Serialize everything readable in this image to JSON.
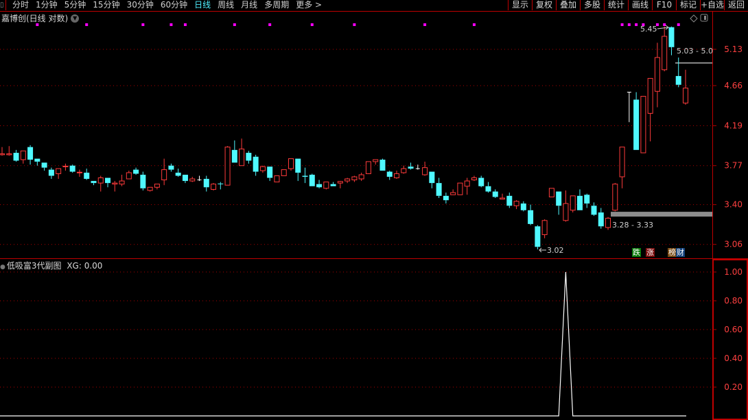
{
  "toolbar": {
    "tabs": [
      "分时",
      "1分钟",
      "5分钟",
      "15分钟",
      "30分钟",
      "60分钟",
      "日线",
      "周线",
      "月线",
      "多周期",
      "更多 >"
    ],
    "active_tab": "日线",
    "buttons": [
      "显示",
      "复权",
      "叠加",
      "多股",
      "统计",
      "画线",
      "F10",
      "标记",
      "+自选",
      "返回"
    ]
  },
  "main_chart": {
    "title": "嘉博创(日线 对数)",
    "scale": "log",
    "y_ticks": [
      "5.13",
      "4.66",
      "4.19",
      "3.77",
      "3.40",
      "3.06"
    ],
    "high_label": "5.45",
    "low_label": "3.02",
    "range_label_low": "3.28 - 3.33",
    "range_label_high": "5.03 - 5.0",
    "badges": {
      "down": "跌",
      "up": "涨",
      "rank": "榜",
      "finance": "财"
    },
    "colors": {
      "up": "#ff3b3b",
      "down": "#4ff8ff",
      "flat": "#ffffff",
      "grid": "#b00000",
      "axis_text": "#ff4040",
      "marker": "#ff00ff",
      "zone": "#8c8c8c"
    },
    "marker_indices": [
      5,
      12,
      20,
      24,
      26,
      33,
      38,
      44,
      50,
      60,
      67,
      88,
      89,
      90,
      91,
      93,
      94,
      96
    ]
  },
  "chart_data": [
    {
      "type": "candlestick",
      "title": "嘉博创(日线 对数)",
      "fields": [
        "open",
        "high",
        "low",
        "close"
      ],
      "ylim": [
        3.0,
        5.5
      ],
      "grid": true,
      "candles": [
        [
          3.88,
          3.96,
          3.87,
          3.89
        ],
        [
          3.88,
          3.97,
          3.87,
          3.89
        ],
        [
          3.9,
          3.93,
          3.81,
          3.82
        ],
        [
          3.83,
          3.92,
          3.79,
          3.92
        ],
        [
          3.96,
          3.98,
          3.78,
          3.83
        ],
        [
          3.84,
          3.84,
          3.77,
          3.81
        ],
        [
          3.8,
          3.8,
          3.72,
          3.75
        ],
        [
          3.73,
          3.75,
          3.64,
          3.67
        ],
        [
          3.69,
          3.74,
          3.64,
          3.74
        ],
        [
          3.76,
          3.79,
          3.72,
          3.765
        ],
        [
          3.77,
          3.78,
          3.7,
          3.71
        ],
        [
          3.7,
          3.73,
          3.66,
          3.705
        ],
        [
          3.7,
          3.74,
          3.63,
          3.64
        ],
        [
          3.62,
          3.62,
          3.58,
          3.6
        ],
        [
          3.6,
          3.67,
          3.52,
          3.65
        ],
        [
          3.65,
          3.65,
          3.56,
          3.6
        ],
        [
          3.59,
          3.62,
          3.52,
          3.6
        ],
        [
          3.59,
          3.68,
          3.57,
          3.62
        ],
        [
          3.64,
          3.72,
          3.64,
          3.7
        ],
        [
          3.73,
          3.75,
          3.68,
          3.69
        ],
        [
          3.68,
          3.71,
          3.53,
          3.55
        ],
        [
          3.53,
          3.56,
          3.52,
          3.56
        ],
        [
          3.56,
          3.59,
          3.54,
          3.59
        ],
        [
          3.63,
          3.84,
          3.58,
          3.73
        ],
        [
          3.77,
          3.79,
          3.71,
          3.73
        ],
        [
          3.7,
          3.74,
          3.66,
          3.67
        ],
        [
          3.68,
          3.68,
          3.6,
          3.62
        ],
        [
          3.62,
          3.66,
          3.61,
          3.64
        ],
        [
          3.63,
          3.67,
          3.62,
          3.63
        ],
        [
          3.64,
          3.67,
          3.52,
          3.56
        ],
        [
          3.54,
          3.6,
          3.53,
          3.59
        ],
        [
          3.595,
          3.61,
          3.54,
          3.59
        ],
        [
          3.58,
          3.97,
          3.58,
          3.96
        ],
        [
          3.93,
          4.03,
          3.8,
          3.8
        ],
        [
          3.77,
          4.05,
          3.77,
          3.94
        ],
        [
          3.9,
          3.92,
          3.79,
          3.82
        ],
        [
          3.86,
          3.88,
          3.67,
          3.71
        ],
        [
          3.72,
          3.77,
          3.7,
          3.76
        ],
        [
          3.76,
          3.76,
          3.62,
          3.65
        ],
        [
          3.61,
          3.67,
          3.61,
          3.67
        ],
        [
          3.67,
          3.73,
          3.67,
          3.73
        ],
        [
          3.74,
          3.84,
          3.72,
          3.84
        ],
        [
          3.84,
          3.84,
          3.62,
          3.7
        ],
        [
          3.67,
          3.75,
          3.6,
          3.66
        ],
        [
          3.68,
          3.69,
          3.57,
          3.57
        ],
        [
          3.59,
          3.63,
          3.55,
          3.56
        ],
        [
          3.55,
          3.61,
          3.54,
          3.61
        ],
        [
          3.59,
          3.61,
          3.57,
          3.57
        ],
        [
          3.6,
          3.62,
          3.55,
          3.615
        ],
        [
          3.62,
          3.65,
          3.6,
          3.64
        ],
        [
          3.63,
          3.67,
          3.61,
          3.66
        ],
        [
          3.64,
          3.7,
          3.62,
          3.68
        ],
        [
          3.69,
          3.81,
          3.69,
          3.81
        ],
        [
          3.81,
          3.83,
          3.78,
          3.83
        ],
        [
          3.83,
          3.84,
          3.72,
          3.72
        ],
        [
          3.71,
          3.72,
          3.63,
          3.66
        ],
        [
          3.65,
          3.72,
          3.64,
          3.69
        ],
        [
          3.7,
          3.77,
          3.69,
          3.74
        ],
        [
          3.76,
          3.8,
          3.73,
          3.74
        ],
        [
          3.74,
          3.78,
          3.73,
          3.74
        ],
        [
          3.68,
          3.81,
          3.67,
          3.75
        ],
        [
          3.71,
          3.71,
          3.55,
          3.6
        ],
        [
          3.6,
          3.65,
          3.46,
          3.48
        ],
        [
          3.48,
          3.51,
          3.41,
          3.44
        ],
        [
          3.49,
          3.54,
          3.49,
          3.51
        ],
        [
          3.49,
          3.6,
          3.49,
          3.6
        ],
        [
          3.57,
          3.65,
          3.49,
          3.62
        ],
        [
          3.63,
          3.67,
          3.62,
          3.65
        ],
        [
          3.65,
          3.67,
          3.56,
          3.57
        ],
        [
          3.57,
          3.61,
          3.51,
          3.52
        ],
        [
          3.52,
          3.54,
          3.46,
          3.47
        ],
        [
          3.45,
          3.5,
          3.45,
          3.46
        ],
        [
          3.48,
          3.51,
          3.37,
          3.39
        ],
        [
          3.39,
          3.44,
          3.36,
          3.43
        ],
        [
          3.41,
          3.43,
          3.34,
          3.35
        ],
        [
          3.35,
          3.4,
          3.22,
          3.23
        ],
        [
          3.21,
          3.22,
          3.02,
          3.04
        ],
        [
          3.14,
          3.27,
          3.11,
          3.26
        ],
        [
          3.47,
          3.55,
          3.47,
          3.55
        ],
        [
          3.52,
          3.52,
          3.31,
          3.39
        ],
        [
          3.26,
          3.53,
          3.25,
          3.41
        ],
        [
          3.35,
          3.48,
          3.33,
          3.48
        ],
        [
          3.48,
          3.54,
          3.35,
          3.35
        ],
        [
          3.49,
          3.5,
          3.37,
          3.41
        ],
        [
          3.39,
          3.42,
          3.3,
          3.31
        ],
        [
          3.33,
          3.37,
          3.19,
          3.21
        ],
        [
          3.2,
          3.29,
          3.18,
          3.28
        ],
        [
          3.35,
          3.6,
          3.34,
          3.59
        ],
        [
          3.66,
          3.96,
          3.55,
          3.96
        ],
        [
          4.58,
          4.58,
          4.23,
          4.58
        ],
        [
          4.49,
          4.58,
          3.93,
          3.93
        ],
        [
          3.9,
          4.53,
          3.9,
          4.53
        ],
        [
          4.33,
          4.75,
          4.02,
          4.75
        ],
        [
          4.59,
          5.22,
          4.4,
          5.02
        ],
        [
          4.86,
          5.45,
          4.84,
          5.31
        ],
        [
          5.44,
          5.45,
          5.05,
          5.16
        ],
        [
          4.78,
          5.02,
          4.64,
          4.67
        ],
        [
          4.45,
          4.86,
          4.43,
          4.63
        ]
      ],
      "zones": [
        {
          "from": 3.28,
          "to": 3.33
        },
        {
          "from": 5.03,
          "to": 5.03
        }
      ]
    },
    {
      "type": "line",
      "title": "低吸富3代副图",
      "series_label": "XG: 0.00",
      "ylim": [
        0,
        1.05
      ],
      "y_ticks": [
        "1.00",
        "0.80",
        "0.60",
        "0.40",
        "0.20"
      ],
      "grid": true,
      "values": [
        0,
        0,
        0,
        0,
        0,
        0,
        0,
        0,
        0,
        0,
        0,
        0,
        0,
        0,
        0,
        0,
        0,
        0,
        0,
        0,
        0,
        0,
        0,
        0,
        0,
        0,
        0,
        0,
        0,
        0,
        0,
        0,
        0,
        0,
        0,
        0,
        0,
        0,
        0,
        0,
        0,
        0,
        0,
        0,
        0,
        0,
        0,
        0,
        0,
        0,
        0,
        0,
        0,
        0,
        0,
        0,
        0,
        0,
        0,
        0,
        0,
        0,
        0,
        0,
        0,
        0,
        0,
        0,
        0,
        0,
        0,
        0,
        0,
        0,
        0,
        0,
        0,
        0,
        0,
        0,
        1,
        0,
        0,
        0,
        0,
        0,
        0,
        0,
        0,
        0,
        0,
        0,
        0,
        0,
        0,
        0,
        0,
        0
      ]
    }
  ],
  "sub_chart": {
    "title": "低吸富3代副图",
    "label": "XG: 0.00"
  }
}
